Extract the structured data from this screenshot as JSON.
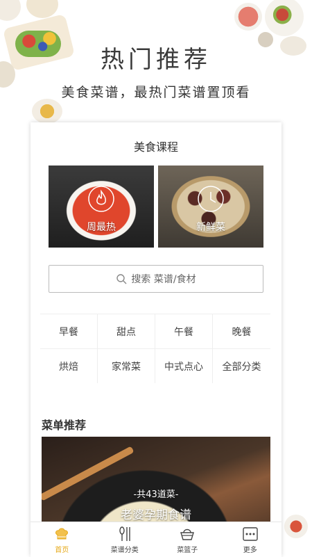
{
  "header": {
    "title": "热门推荐",
    "subtitle": "美食菜谱，最热门菜谱置顶看"
  },
  "courses": {
    "title": "美食课程",
    "items": [
      {
        "label": "周最热",
        "icon": "flame-icon"
      },
      {
        "label": "新鲜菜",
        "icon": "clock-icon"
      }
    ]
  },
  "search": {
    "placeholder": "搜索 菜谱/食材"
  },
  "categories": [
    "早餐",
    "甜点",
    "午餐",
    "晚餐",
    "烘焙",
    "家常菜",
    "中式点心",
    "全部分类"
  ],
  "recommend": {
    "title": "菜单推荐",
    "count": "-共43道菜-",
    "name": "老婆孕期食谱"
  },
  "tabbar": {
    "items": [
      {
        "label": "首页",
        "icon": "chef-hat-icon",
        "active": true
      },
      {
        "label": "菜谱分类",
        "icon": "utensils-icon",
        "active": false
      },
      {
        "label": "菜篮子",
        "icon": "basket-icon",
        "active": false
      },
      {
        "label": "更多",
        "icon": "more-icon",
        "active": false
      }
    ]
  },
  "colors": {
    "accent": "#e6a817"
  }
}
